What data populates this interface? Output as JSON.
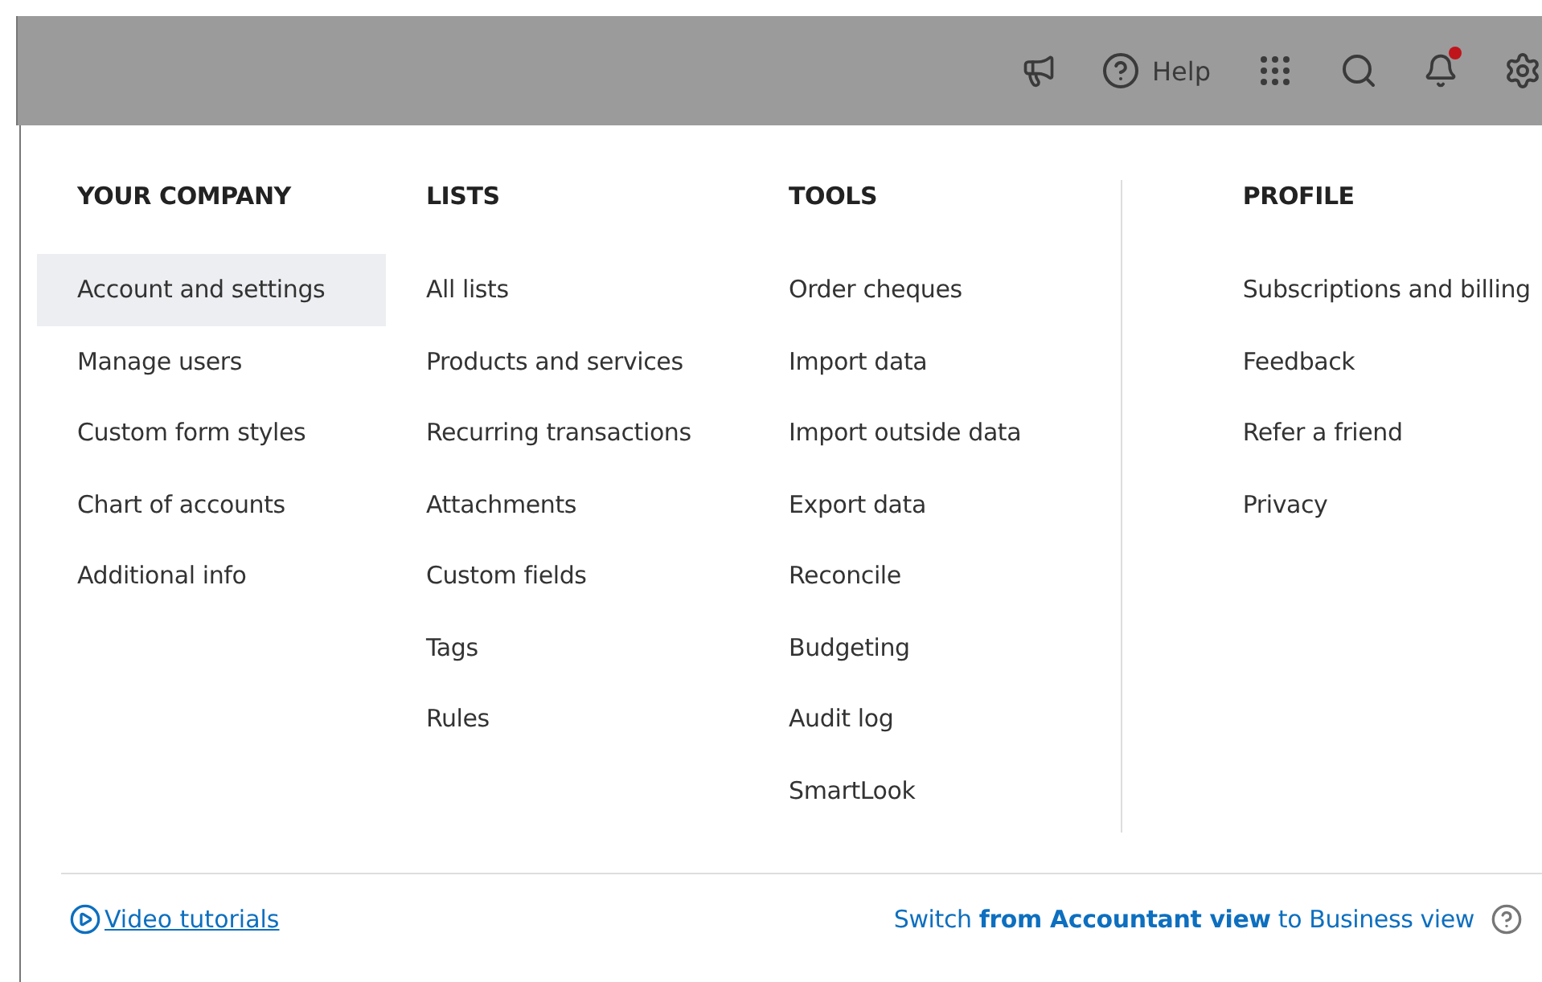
{
  "topbar": {
    "items": [
      {
        "kind": "megaphone"
      },
      {
        "kind": "help",
        "label": "Help"
      },
      {
        "kind": "apps"
      },
      {
        "kind": "search"
      },
      {
        "kind": "bell",
        "alert": true
      },
      {
        "kind": "gear"
      }
    ]
  },
  "columns": [
    {
      "title": "YOUR COMPANY",
      "items": [
        {
          "label": "Account and settings",
          "selected": true
        },
        {
          "label": "Manage users",
          "selected": false
        },
        {
          "label": "Custom form styles",
          "selected": false
        },
        {
          "label": "Chart of accounts",
          "selected": false
        },
        {
          "label": "Additional info",
          "selected": false
        }
      ]
    },
    {
      "title": "LISTS",
      "items": [
        {
          "label": "All lists",
          "selected": false
        },
        {
          "label": "Products and services",
          "selected": false
        },
        {
          "label": "Recurring transactions",
          "selected": false
        },
        {
          "label": "Attachments",
          "selected": false
        },
        {
          "label": "Custom fields",
          "selected": false
        },
        {
          "label": "Tags",
          "selected": false
        },
        {
          "label": "Rules",
          "selected": false
        }
      ]
    },
    {
      "title": "TOOLS",
      "items": [
        {
          "label": "Order cheques",
          "selected": false
        },
        {
          "label": "Import data",
          "selected": false
        },
        {
          "label": "Import outside data",
          "selected": false
        },
        {
          "label": "Export data",
          "selected": false
        },
        {
          "label": "Reconcile",
          "selected": false
        },
        {
          "label": "Budgeting",
          "selected": false
        },
        {
          "label": "Audit log",
          "selected": false
        },
        {
          "label": "SmartLook",
          "selected": false
        }
      ]
    },
    {
      "title": "PROFILE",
      "items": [
        {
          "label": "Subscriptions and billing",
          "selected": false
        },
        {
          "label": "Feedback",
          "selected": false
        },
        {
          "label": "Refer a friend",
          "selected": false
        },
        {
          "label": "Privacy",
          "selected": false
        }
      ]
    }
  ],
  "footer": {
    "video_link": "Video tutorials",
    "switch_text": "Switch **from Accountant view** to Business view"
  }
}
